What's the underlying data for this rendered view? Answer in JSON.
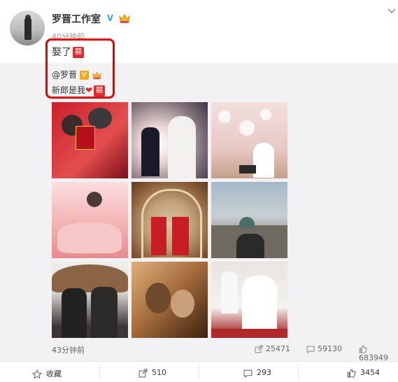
{
  "post": {
    "author": "罗晋工作室",
    "verified_mark": "V",
    "time": "40分钟前",
    "text": "娶了",
    "xi": "囍"
  },
  "repost": {
    "mention": "@罗晋",
    "mention_mark": "V",
    "line2": "新郎是我",
    "heart": "❤",
    "xi": "囍",
    "time": "43分钟前",
    "stats": {
      "reposts": "25471",
      "comments": "59130",
      "likes": "683949"
    }
  },
  "actions": {
    "favorite": "收藏",
    "repost": "510",
    "comment": "293",
    "like": "3454"
  },
  "colors": {
    "highlight": "#e60000",
    "verified": "#1d8ff0",
    "repost_bg": "#f2f2f5"
  },
  "icons": [
    "chevron-down-icon",
    "star-icon",
    "repost-icon",
    "comment-icon",
    "like-icon",
    "verified-icon",
    "crown-icon"
  ]
}
